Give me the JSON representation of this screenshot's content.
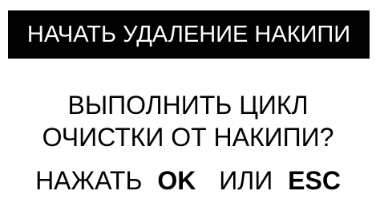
{
  "screen": {
    "title": "НАЧАТЬ УДАЛЕНИЕ НАКИПИ",
    "message_line1": "ВЫПОЛНИТЬ ЦИКЛ",
    "message_line2": "ОЧИСТКИ ОТ НАКИПИ?",
    "prompt_press": "НАЖАТЬ",
    "prompt_ok": "OK",
    "prompt_or": "ИЛИ",
    "prompt_esc": "ESC"
  },
  "colors": {
    "background": "#ffffff",
    "title_bar_bg": "#000000",
    "title_text": "#ffffff",
    "text": "#000000"
  }
}
